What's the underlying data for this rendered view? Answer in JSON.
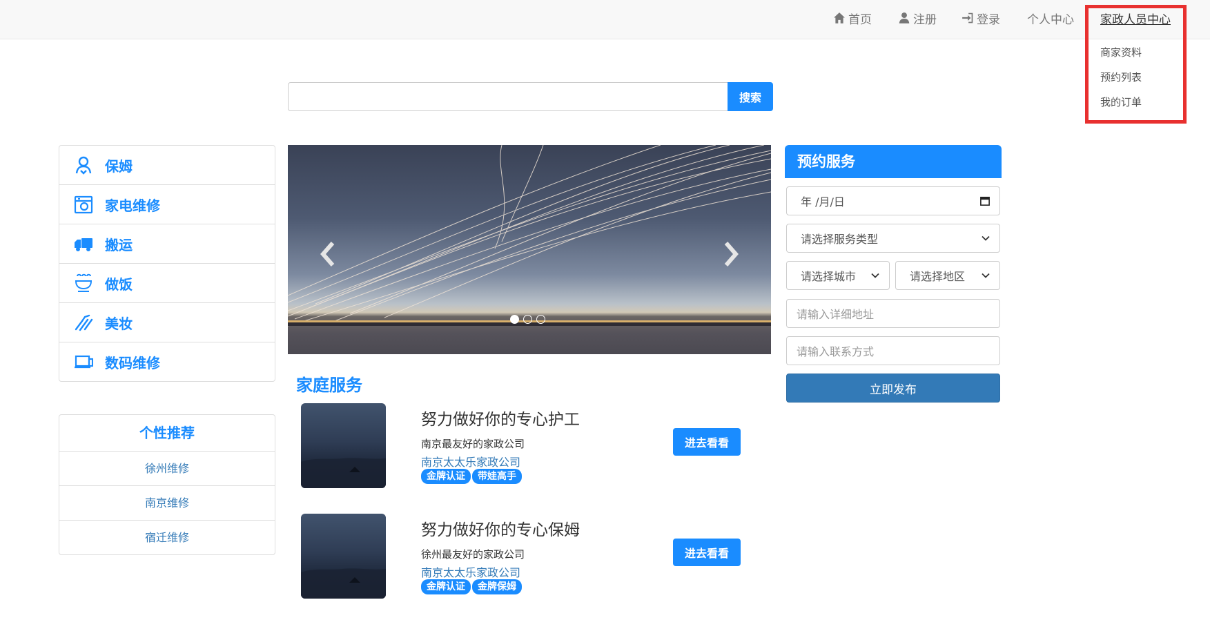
{
  "nav": {
    "home": "首页",
    "register": "注册",
    "login": "登录",
    "personal_center": "个人中心",
    "staff_center": "家政人员中心"
  },
  "dropdown": {
    "items": [
      "商家资料",
      "预约列表",
      "我的订单"
    ]
  },
  "search": {
    "value": "",
    "button": "搜索"
  },
  "categories": [
    {
      "label": "保姆",
      "icon": "nanny-icon"
    },
    {
      "label": "家电维修",
      "icon": "appliance-icon"
    },
    {
      "label": "搬运",
      "icon": "truck-icon"
    },
    {
      "label": "做饭",
      "icon": "cooking-icon"
    },
    {
      "label": "美妆",
      "icon": "makeup-icon"
    },
    {
      "label": "数码维修",
      "icon": "laptop-icon"
    }
  ],
  "recommend": {
    "title": "个性推荐",
    "items": [
      "徐州维修",
      "南京维修",
      "宿迁维修"
    ]
  },
  "carousel": {
    "slide_count": 3,
    "active_slide": 1
  },
  "home_services": {
    "title": "家庭服务",
    "items": [
      {
        "title": "努力做好你的专心护工",
        "company": "南京最友好的家政公司",
        "agency": "南京太太乐家政公司",
        "tags": [
          "金牌认证",
          "带娃高手"
        ],
        "button": "进去看看"
      },
      {
        "title": "努力做好你的专心保姆",
        "company": "徐州最友好的家政公司",
        "agency": "南京太太乐家政公司",
        "tags": [
          "金牌认证",
          "金牌保姆"
        ],
        "button": "进去看看"
      }
    ]
  },
  "booking": {
    "title": "预约服务",
    "date_placeholder": "年 /月/日",
    "service_type": "请选择服务类型",
    "city": "请选择城市",
    "district": "请选择地区",
    "address_placeholder": "请输入详细地址",
    "contact_placeholder": "请输入联系方式",
    "submit": "立即发布"
  },
  "colors": {
    "accent": "#1a8cff",
    "link": "#337ab7",
    "highlight": "#e8302f"
  }
}
